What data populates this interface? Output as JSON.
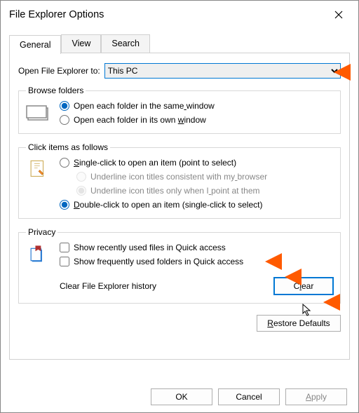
{
  "title": "File Explorer Options",
  "tabs": {
    "general": "General",
    "view": "View",
    "search": "Search"
  },
  "open_label": "Open File Explorer to:",
  "open_value": "This PC",
  "browse": {
    "legend": "Browse folders",
    "same": "Open each folder in the same window",
    "own": "Open each folder in its own window"
  },
  "click": {
    "legend": "Click items as follows",
    "single": "Single-click to open an item (point to select)",
    "underline_browser": "Underline icon titles consistent with my browser",
    "underline_point": "Underline icon titles only when I point at them",
    "double": "Double-click to open an item (single-click to select)"
  },
  "privacy": {
    "legend": "Privacy",
    "recent_files": "Show recently used files in Quick access",
    "frequent_folders": "Show frequently used folders in Quick access",
    "clear_label": "Clear File Explorer history",
    "clear_btn": "Clear"
  },
  "restore": "Restore Defaults",
  "buttons": {
    "ok": "OK",
    "cancel": "Cancel",
    "apply": "Apply"
  }
}
